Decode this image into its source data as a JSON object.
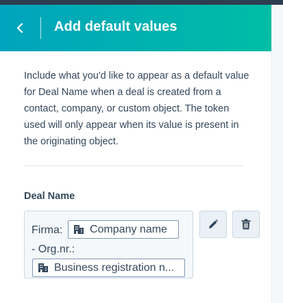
{
  "panel": {
    "title": "Add default values",
    "description": "Include what you'd like to appear as a default value for Deal Name when a deal is created from a contact, company, or custom object. The token used will only appear when its value is present in the originating object.",
    "field_label": "Deal Name",
    "editor": {
      "prefix_text": "Firma:",
      "token_1": {
        "label": "Company name",
        "icon": "building-icon"
      },
      "middle_text": "-  Org.nr.:",
      "token_2": {
        "label": "Business registration n...",
        "icon": "building-icon"
      }
    },
    "actions": {
      "edit_icon": "pencil-icon",
      "delete_icon": "trash-icon"
    }
  },
  "colors": {
    "header_gradient_start": "#00a4bd",
    "header_gradient_end": "#00bda5",
    "text": "#33475b",
    "button_bg": "#eaf0f6"
  }
}
